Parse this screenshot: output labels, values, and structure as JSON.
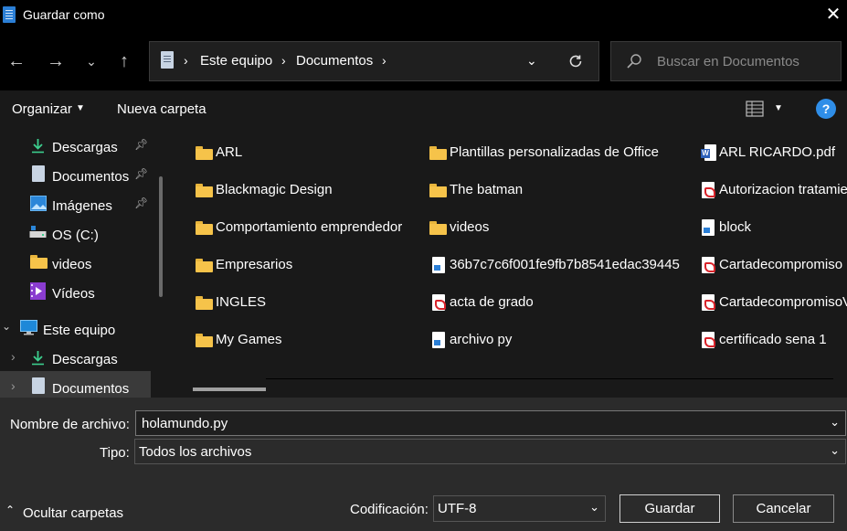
{
  "window": {
    "title": "Guardar como"
  },
  "nav": {
    "breadcrumb": [
      "Este equipo",
      "Documentos"
    ],
    "search_placeholder": "Buscar en Documentos"
  },
  "toolbar": {
    "organize": "Organizar",
    "new_folder": "Nueva carpeta"
  },
  "sidebar": {
    "items": [
      {
        "label": "Descargas",
        "icon": "download-icon",
        "pinned": true
      },
      {
        "label": "Documentos",
        "icon": "document-icon",
        "pinned": true
      },
      {
        "label": "Imágenes",
        "icon": "image-icon",
        "pinned": true
      },
      {
        "label": "OS (C:)",
        "icon": "drive-icon",
        "pinned": false
      },
      {
        "label": "videos",
        "icon": "folder-icon",
        "pinned": false
      },
      {
        "label": "Vídeos",
        "icon": "video-icon",
        "pinned": false
      },
      {
        "label": "Este equipo",
        "icon": "computer-icon",
        "expanded": true
      },
      {
        "label": "Descargas",
        "icon": "download-icon",
        "child": true
      },
      {
        "label": "Documentos",
        "icon": "document-icon",
        "child": true,
        "selected": true
      }
    ]
  },
  "files": {
    "col1": [
      {
        "name": "ARL",
        "type": "folder"
      },
      {
        "name": "Blackmagic Design",
        "type": "folder"
      },
      {
        "name": "Comportamiento emprendedor",
        "type": "folder"
      },
      {
        "name": "Empresarios",
        "type": "folder"
      },
      {
        "name": "INGLES",
        "type": "folder"
      },
      {
        "name": "My Games",
        "type": "folder"
      }
    ],
    "col2": [
      {
        "name": "Plantillas personalizadas de Office",
        "type": "folder"
      },
      {
        "name": "The batman",
        "type": "folder"
      },
      {
        "name": "videos",
        "type": "folder"
      },
      {
        "name": "36b7c7c6f001fe9fb7b8541edac39445",
        "type": "generic"
      },
      {
        "name": "acta de grado",
        "type": "pdf"
      },
      {
        "name": "archivo py",
        "type": "generic"
      }
    ],
    "col3": [
      {
        "name": "ARL RICARDO.pdf",
        "type": "word"
      },
      {
        "name": "Autorizacion tratamie",
        "type": "pdf"
      },
      {
        "name": "block",
        "type": "generic"
      },
      {
        "name": "Cartadecompromiso",
        "type": "pdf"
      },
      {
        "name": "CartadecompromisoV",
        "type": "pdf"
      },
      {
        "name": "certificado sena 1",
        "type": "pdf"
      }
    ]
  },
  "form": {
    "filename_label": "Nombre de archivo:",
    "filename_value": "holamundo.py",
    "type_label": "Tipo:",
    "type_value": "Todos los archivos",
    "encoding_label": "Codificación:",
    "encoding_value": "UTF-8",
    "hide_folders": "Ocultar carpetas",
    "save": "Guardar",
    "cancel": "Cancelar"
  }
}
